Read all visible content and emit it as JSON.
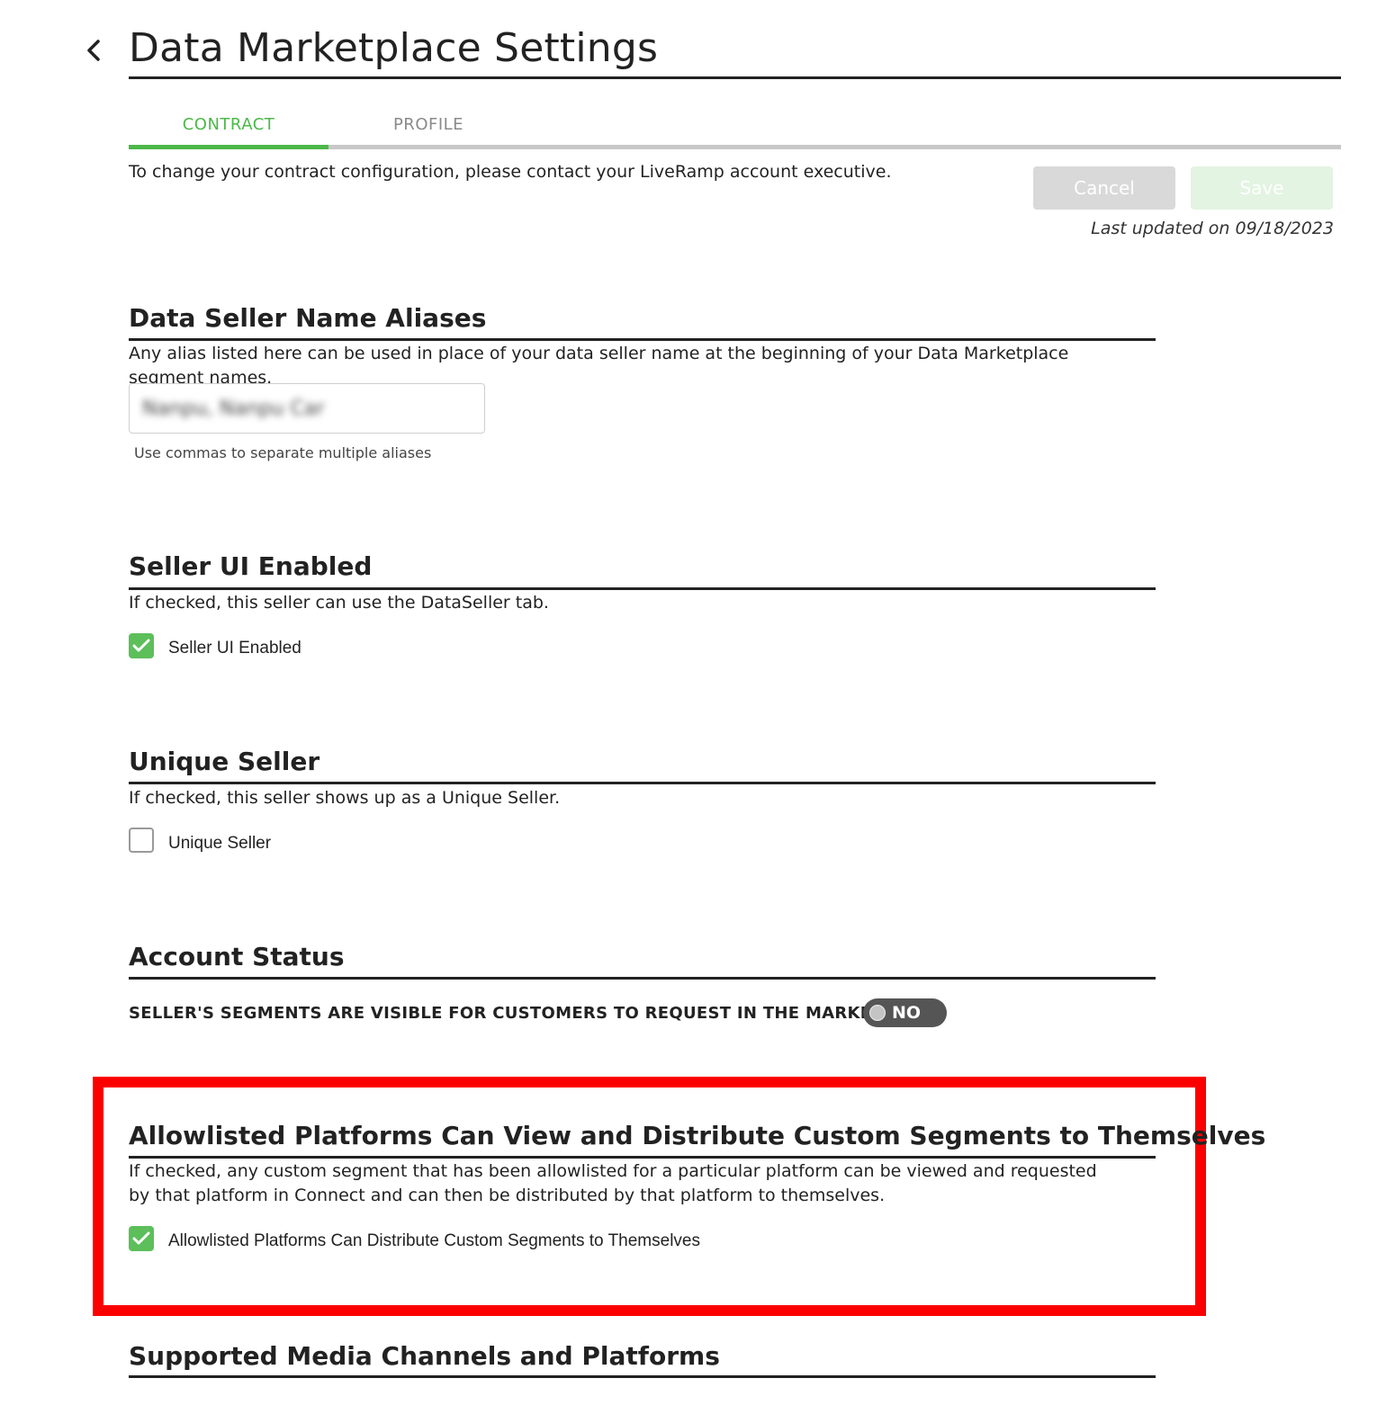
{
  "header": {
    "title": "Data Marketplace Settings",
    "back_icon": "chevron-left-icon"
  },
  "tabs": [
    {
      "label": "CONTRACT",
      "active": true
    },
    {
      "label": "PROFILE",
      "active": false
    }
  ],
  "contract_note": "To change your contract configuration, please contact your LiveRamp account executive.",
  "actions": {
    "cancel_label": "Cancel",
    "save_label": "Save",
    "last_updated": "Last updated on 09/18/2023"
  },
  "aliases": {
    "title": "Data Seller Name Aliases",
    "description": "Any alias listed here can be used in place of your data seller name at the beginning of your Data Marketplace segment names.",
    "value": "Nanpu, Nanpu Car",
    "hint": "Use commas to separate multiple aliases"
  },
  "seller_ui": {
    "title": "Seller UI Enabled",
    "description": "If checked, this seller can use the DataSeller tab.",
    "checkbox_label": "Seller UI Enabled",
    "checked": true
  },
  "unique_seller": {
    "title": "Unique Seller",
    "description": "If checked, this seller shows up as a Unique Seller.",
    "checkbox_label": "Unique Seller",
    "checked": false
  },
  "account_status": {
    "title": "Account Status",
    "visibility_label": "SELLER'S SEGMENTS ARE VISIBLE FOR CUSTOMERS TO REQUEST IN THE MARKETPLACE",
    "toggle_text": "NO",
    "toggle_on": false
  },
  "allowlisted": {
    "title": "Allowlisted Platforms Can View and Distribute Custom Segments to Themselves",
    "description": "If checked, any custom segment that has been allowlisted for a particular platform can be viewed and requested by that platform in Connect and can then be distributed by that platform to themselves.",
    "checkbox_label": "Allowlisted Platforms Can Distribute Custom Segments to Themselves",
    "checked": true
  },
  "media_channels": {
    "title": "Supported Media Channels and Platforms"
  },
  "colors": {
    "accent_green": "#4cb848",
    "checkbox_green": "#5cbf5a",
    "highlight_red": "#fc0000",
    "toggle_off": "#555555"
  }
}
